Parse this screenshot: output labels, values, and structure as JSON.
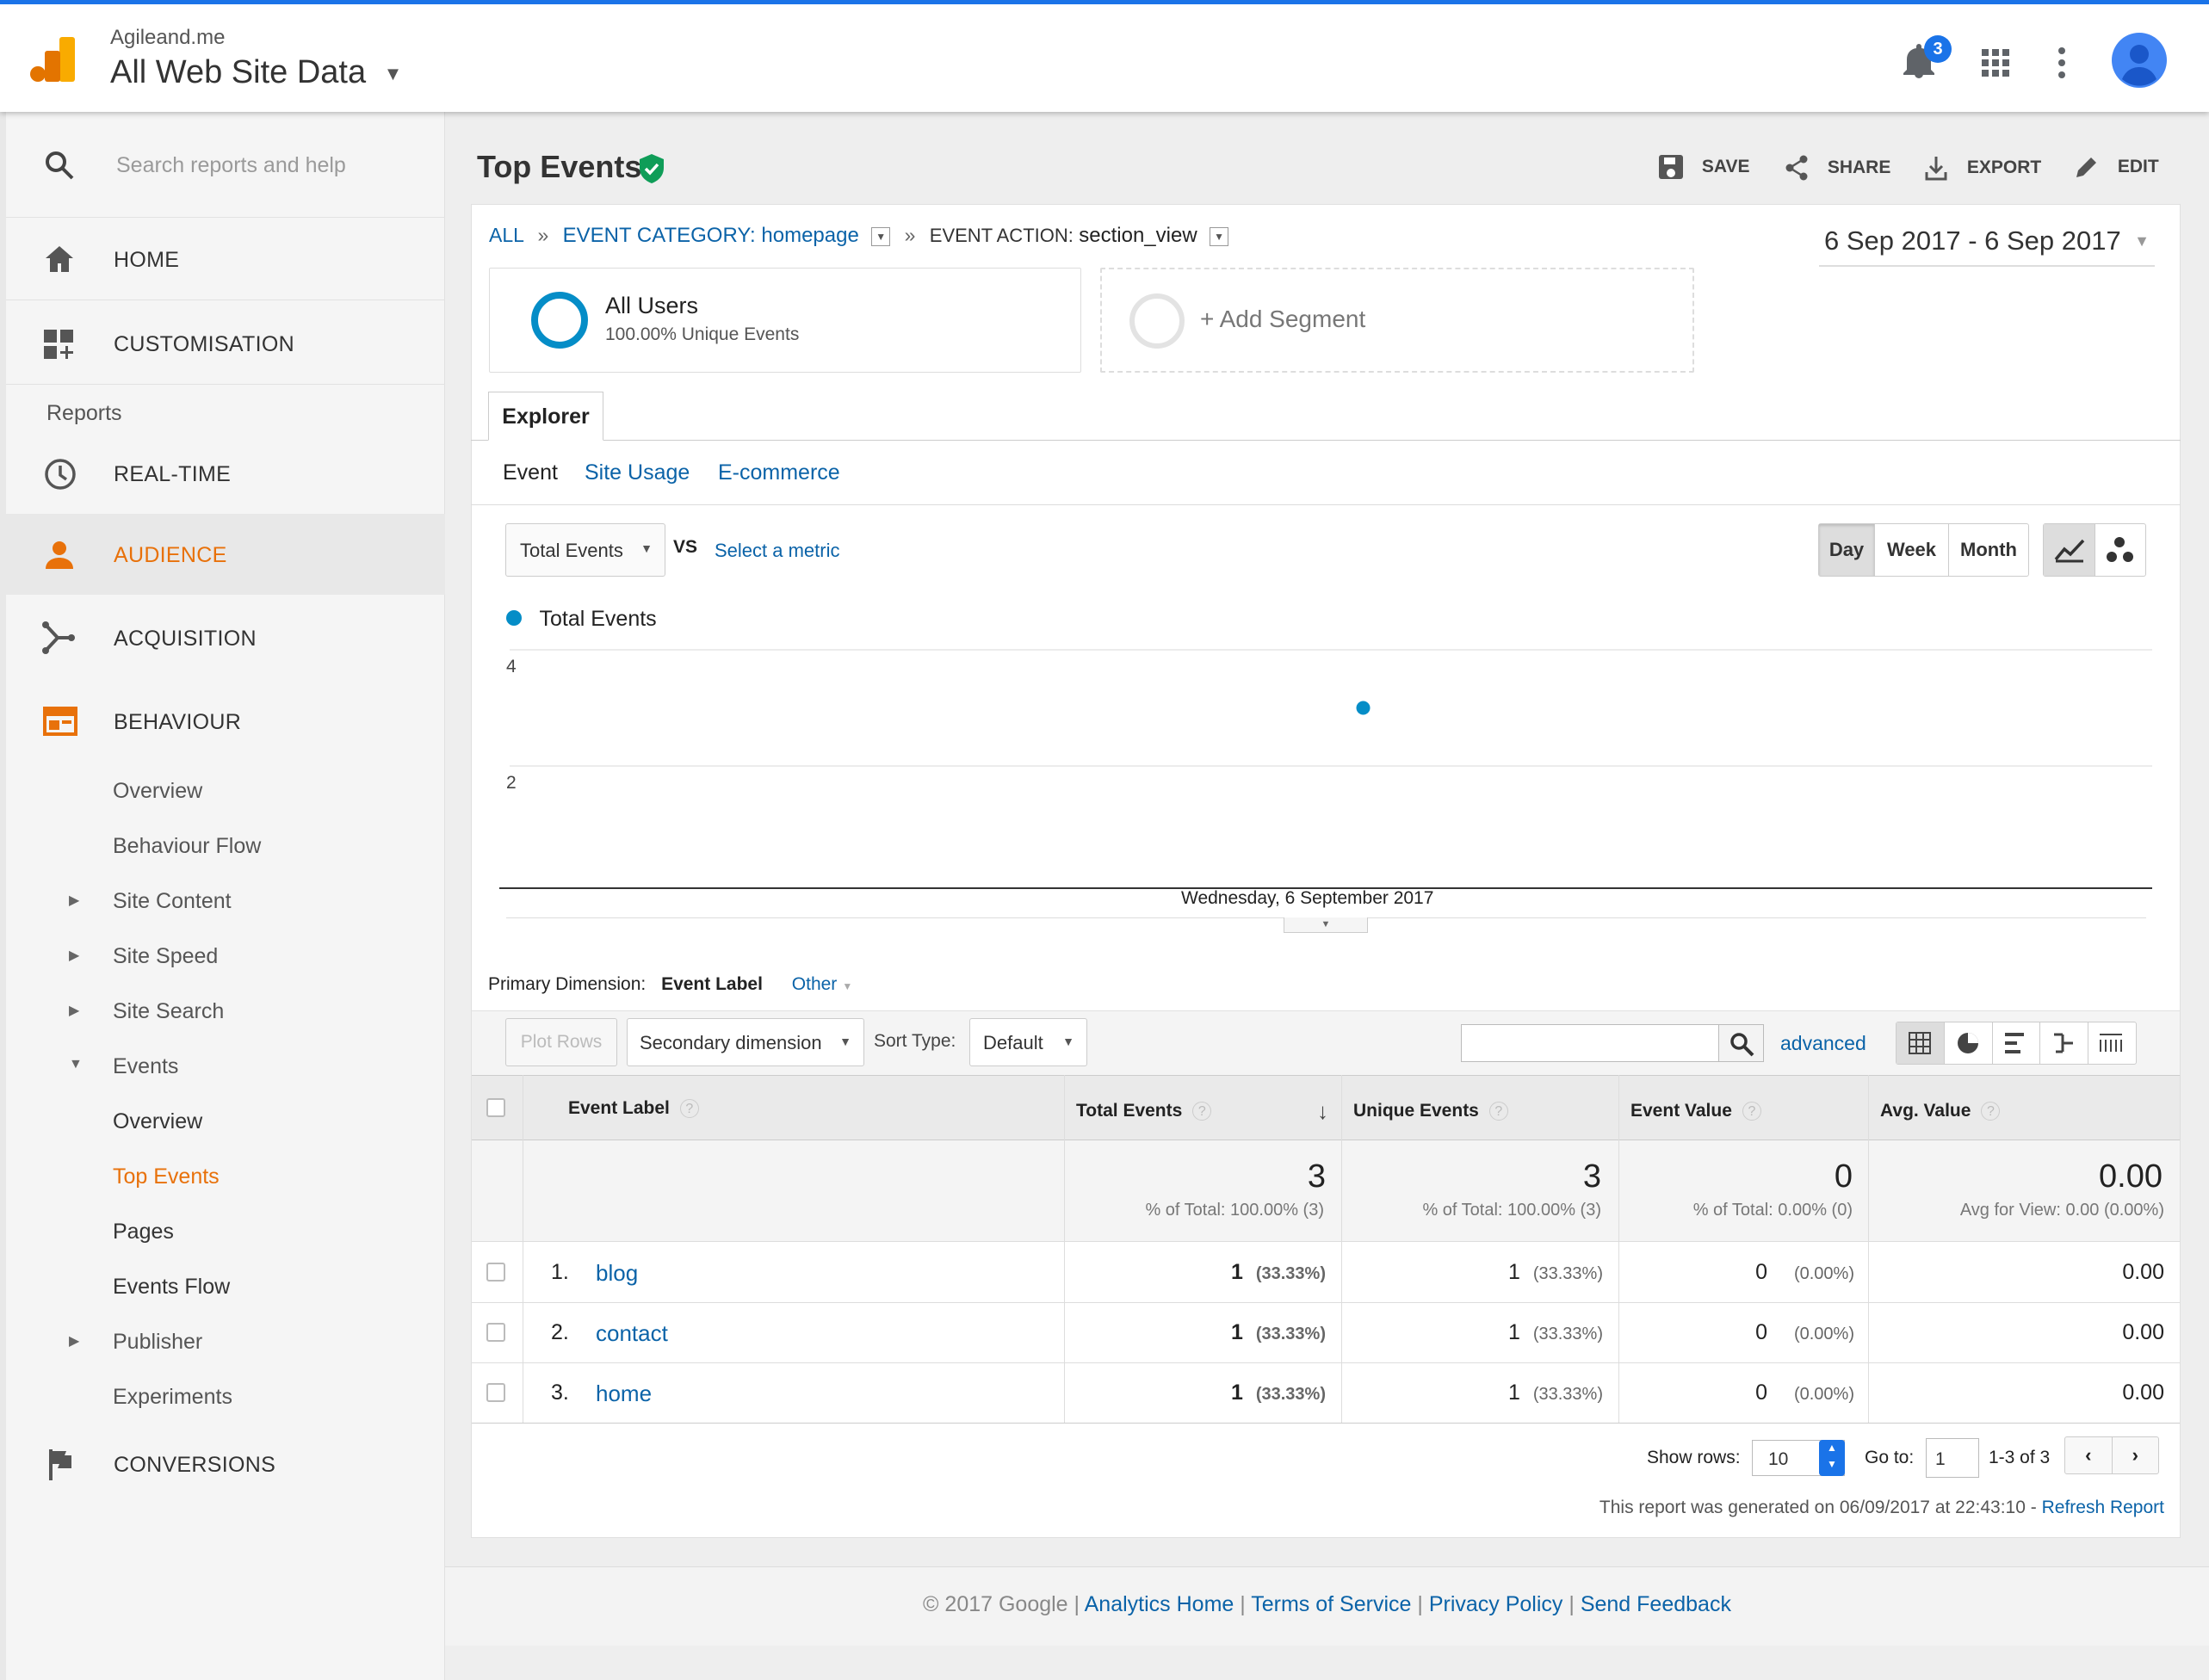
{
  "header": {
    "account": "Agileand.me",
    "property": "All Web Site Data",
    "notification_count": "3",
    "icons": [
      "analytics-logo-icon",
      "bell-icon",
      "apps-grid-icon",
      "more-vert-icon",
      "avatar-icon"
    ]
  },
  "sidebar": {
    "search_placeholder": "Search reports and help",
    "home": "HOME",
    "customisation": "CUSTOMISATION",
    "reports_heading": "Reports",
    "realtime": "REAL-TIME",
    "audience": "AUDIENCE",
    "acquisition": "ACQUISITION",
    "behaviour": "BEHAVIOUR",
    "behaviour_items": [
      "Overview",
      "Behaviour Flow",
      "Site Content",
      "Site Speed",
      "Site Search",
      "Events"
    ],
    "events_items": [
      "Overview",
      "Top Events",
      "Pages",
      "Events Flow"
    ],
    "after_items": [
      "Publisher",
      "Experiments"
    ],
    "conversions": "CONVERSIONS"
  },
  "report": {
    "title": "Top Events",
    "actions": {
      "save": "SAVE",
      "share": "SHARE",
      "export": "EXPORT",
      "edit": "EDIT"
    },
    "breadcrumb": {
      "all": "ALL",
      "sep": "»",
      "category_label": "EVENT CATEGORY: homepage",
      "action_prefix": "EVENT ACTION:",
      "action_value": "section_view"
    },
    "date_range": "6 Sep 2017 - 6 Sep 2017",
    "segment": {
      "name": "All Users",
      "sub": "100.00% Unique Events",
      "add": "+ Add Segment"
    },
    "explorer_tab": "Explorer",
    "subtabs": [
      "Event",
      "Site Usage",
      "E-commerce"
    ],
    "metric": "Total Events",
    "vs": "VS",
    "select_metric": "Select a metric",
    "period_buttons": [
      "Day",
      "Week",
      "Month"
    ],
    "legend": "Total Events",
    "x_label": "Wednesday, 6 September 2017"
  },
  "chart_data": {
    "type": "scatter",
    "series": [
      {
        "name": "Total Events",
        "color": "#058dc7",
        "x": [
          "Wednesday, 6 September 2017"
        ],
        "values": [
          3
        ]
      }
    ],
    "y_ticks": [
      4,
      2
    ],
    "ylim": [
      0,
      4
    ],
    "grid": true
  },
  "table_controls": {
    "primary_dimension_label": "Primary Dimension:",
    "primary_dimension_value": "Event Label",
    "other": "Other",
    "plot_rows": "Plot Rows",
    "secondary_dimension": "Secondary dimension",
    "sort_type_label": "Sort Type:",
    "sort_type_value": "Default",
    "advanced": "advanced"
  },
  "table": {
    "headers": [
      "Event Label",
      "Total Events",
      "Unique Events",
      "Event Value",
      "Avg. Value"
    ],
    "totals": [
      {
        "value": "3",
        "sub": "% of Total: 100.00% (3)"
      },
      {
        "value": "3",
        "sub": "% of Total: 100.00% (3)"
      },
      {
        "value": "0",
        "sub": "% of Total: 0.00% (0)"
      },
      {
        "value": "0.00",
        "sub": "Avg for View: 0.00 (0.00%)"
      }
    ],
    "rows": [
      {
        "index": "1.",
        "label": "blog",
        "total": "1",
        "total_pct": "(33.33%)",
        "unique": "1",
        "unique_pct": "(33.33%)",
        "value": "0",
        "value_pct": "(0.00%)",
        "avg": "0.00"
      },
      {
        "index": "2.",
        "label": "contact",
        "total": "1",
        "total_pct": "(33.33%)",
        "unique": "1",
        "unique_pct": "(33.33%)",
        "value": "0",
        "value_pct": "(0.00%)",
        "avg": "0.00"
      },
      {
        "index": "3.",
        "label": "home",
        "total": "1",
        "total_pct": "(33.33%)",
        "unique": "1",
        "unique_pct": "(33.33%)",
        "value": "0",
        "value_pct": "(0.00%)",
        "avg": "0.00"
      }
    ]
  },
  "pagination": {
    "show_rows_label": "Show rows:",
    "show_rows_value": "10",
    "goto_label": "Go to:",
    "goto_value": "1",
    "range": "1-3 of 3"
  },
  "generated": {
    "text": "This report was generated on 06/09/2017 at 22:43:10 -",
    "refresh": "Refresh Report"
  },
  "footer": {
    "copyright": "© 2017 Google",
    "sep": "|",
    "links": [
      "Analytics Home",
      "Terms of Service",
      "Privacy Policy",
      "Send Feedback"
    ]
  }
}
